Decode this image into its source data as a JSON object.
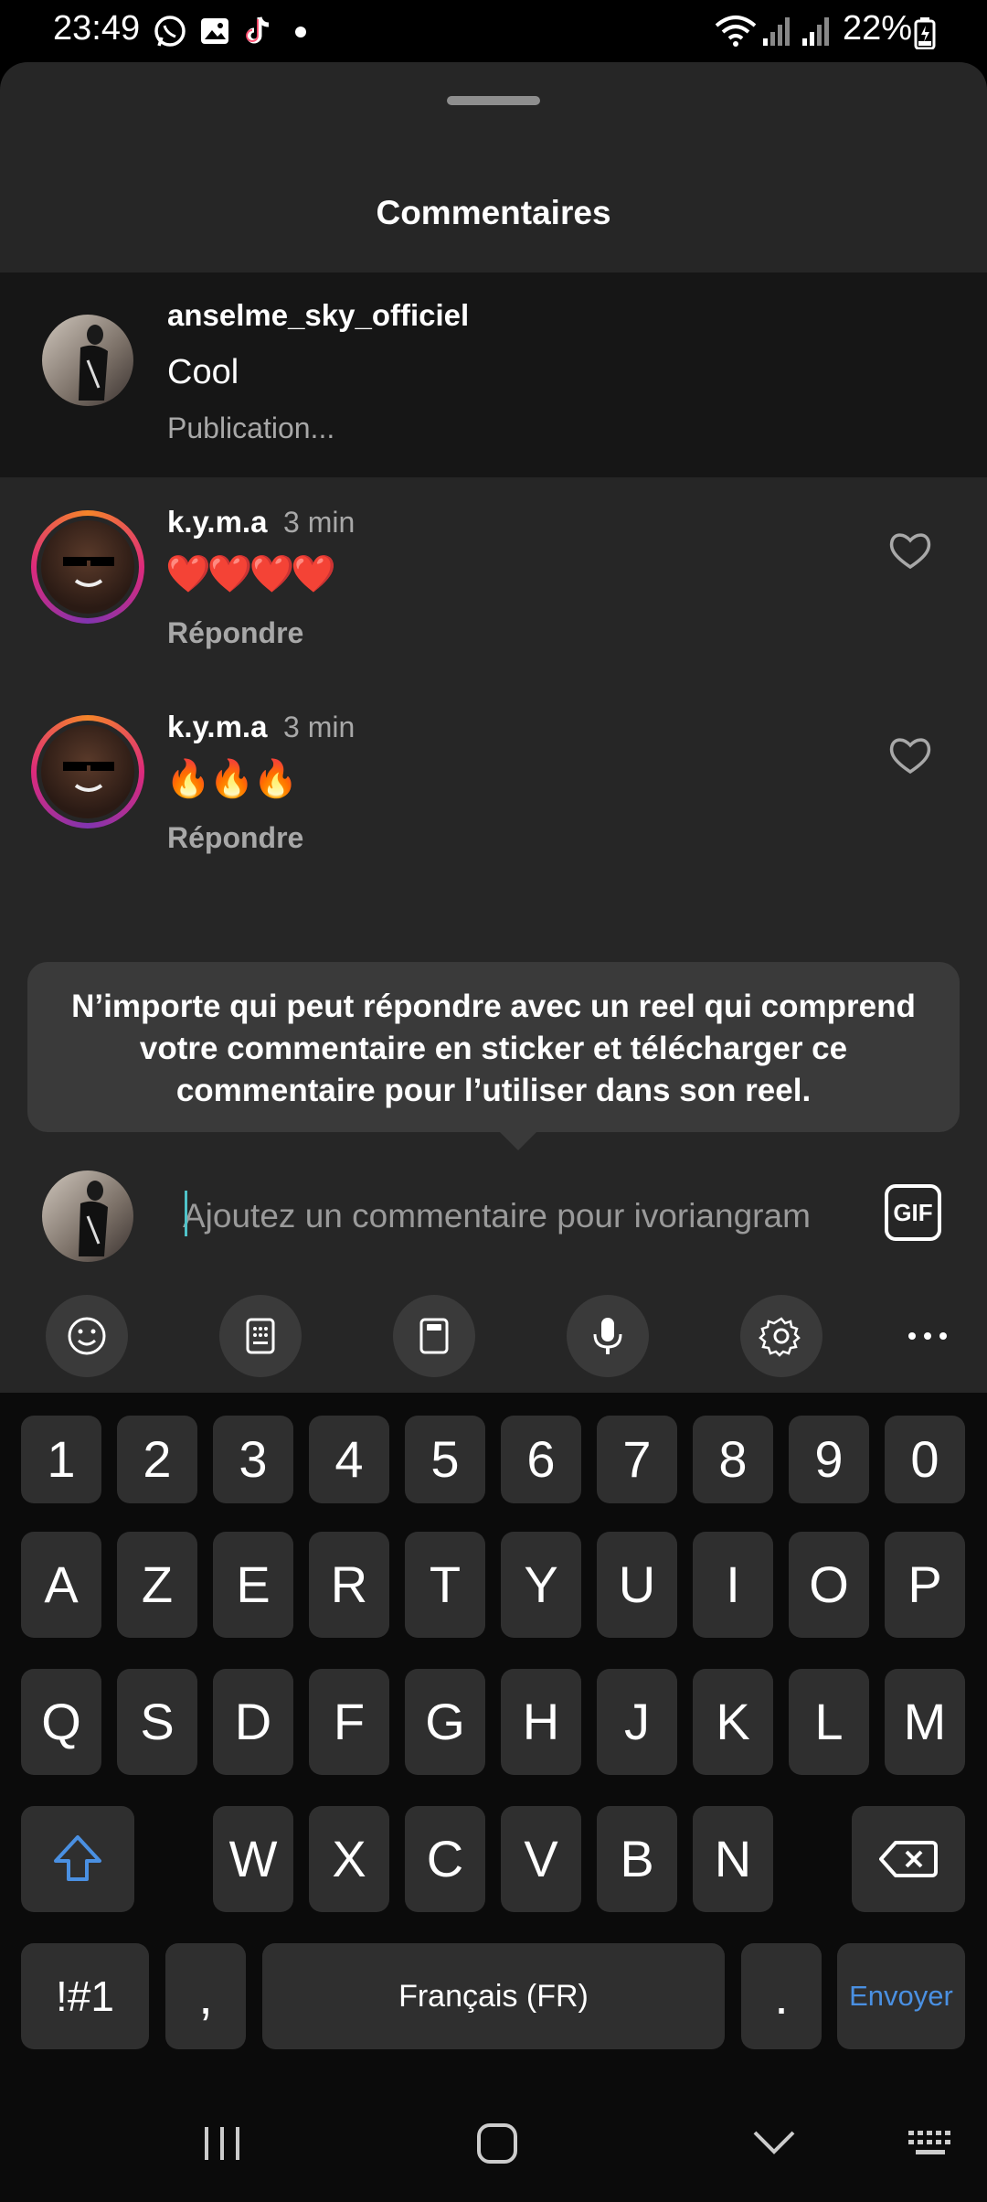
{
  "status": {
    "time": "23:49",
    "battery": "22%"
  },
  "sheet": {
    "title": "Commentaires"
  },
  "caption": {
    "username": "anselme_sky_officiel",
    "text": "Cool",
    "status": "Publication..."
  },
  "comments": [
    {
      "username": "k.y.m.a",
      "time": "3 min",
      "text": "❤️❤️❤️❤️",
      "reply": "Répondre"
    },
    {
      "username": "k.y.m.a",
      "time": "3 min",
      "text": "🔥🔥🔥",
      "reply": "Répondre"
    }
  ],
  "tooltip": {
    "text": "N’importe qui peut répondre avec un reel qui comprend votre commentaire en sticker et télécharger ce commentaire pour l’utiliser dans son reel."
  },
  "composer": {
    "placeholder": "Ajoutez un commentaire pour ivoriangram",
    "gif_label": "GIF"
  },
  "keyboard": {
    "row_numbers": [
      "1",
      "2",
      "3",
      "4",
      "5",
      "6",
      "7",
      "8",
      "9",
      "0"
    ],
    "row1": [
      "A",
      "Z",
      "E",
      "R",
      "T",
      "Y",
      "U",
      "I",
      "O",
      "P"
    ],
    "row2": [
      "Q",
      "S",
      "D",
      "F",
      "G",
      "H",
      "J",
      "K",
      "L",
      "M"
    ],
    "row3": [
      "W",
      "X",
      "C",
      "V",
      "B",
      "N"
    ],
    "symbols": "!#1",
    "comma": ",",
    "space": "Français (FR)",
    "period": ".",
    "send": "Envoyer"
  },
  "colors": {
    "sheet": "#262626",
    "caption_bg": "#161616",
    "key": "#2f2f2f",
    "accent": "#4a90e2"
  }
}
